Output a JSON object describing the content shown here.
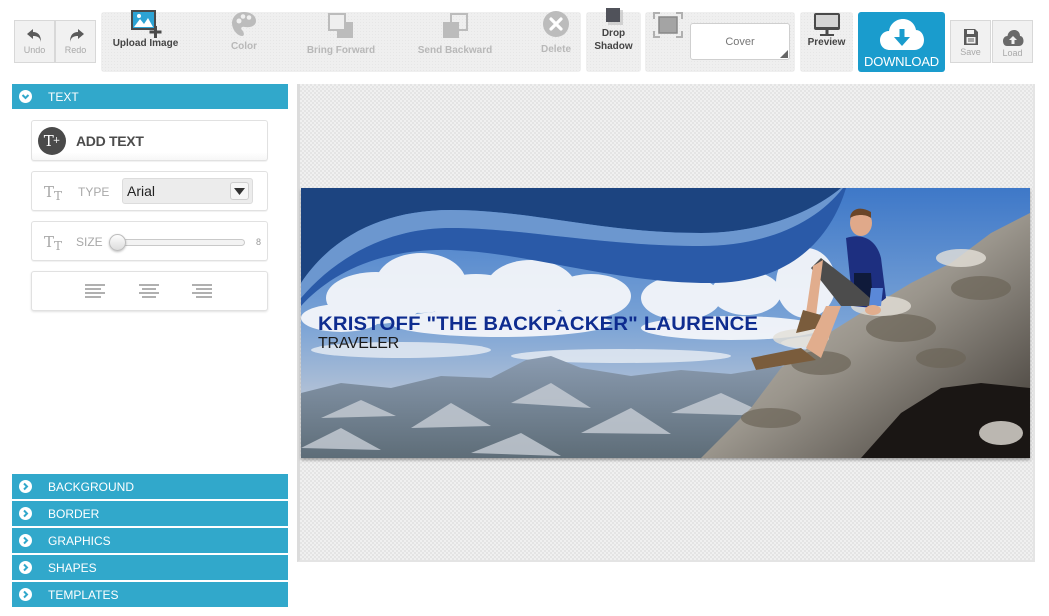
{
  "toolbar": {
    "undo": "Undo",
    "redo": "Redo",
    "upload_image": "Upload Image",
    "color": "Color",
    "bring_forward": "Bring Forward",
    "send_backward": "Send Backward",
    "delete": "Delete",
    "drop_shadow_line1": "Drop",
    "drop_shadow_line2": "Shadow",
    "fit_mode": "Cover",
    "preview": "Preview",
    "download": "DOWNLOAD",
    "save": "Save",
    "load": "Load",
    "accent_color": "#1a9ccd"
  },
  "sidebar": {
    "header_color": "#31a8cb",
    "text_section": {
      "title": "TEXT",
      "expanded": true,
      "add_text": "ADD TEXT",
      "type_label": "TYPE",
      "font_value": "Arial",
      "size_label": "SIZE",
      "size_value": "8",
      "alignments": [
        "left",
        "center",
        "right"
      ]
    },
    "collapsed_sections": [
      {
        "title": "BACKGROUND"
      },
      {
        "title": "BORDER"
      },
      {
        "title": "GRAPHICS"
      },
      {
        "title": "SHAPES"
      },
      {
        "title": "TEMPLATES"
      }
    ]
  },
  "banner": {
    "name": "KRISTOFF \"THE BACKPACKER\" LAURENCE",
    "subtitle": "TRAVELER",
    "name_color": "#0e2c8f"
  }
}
